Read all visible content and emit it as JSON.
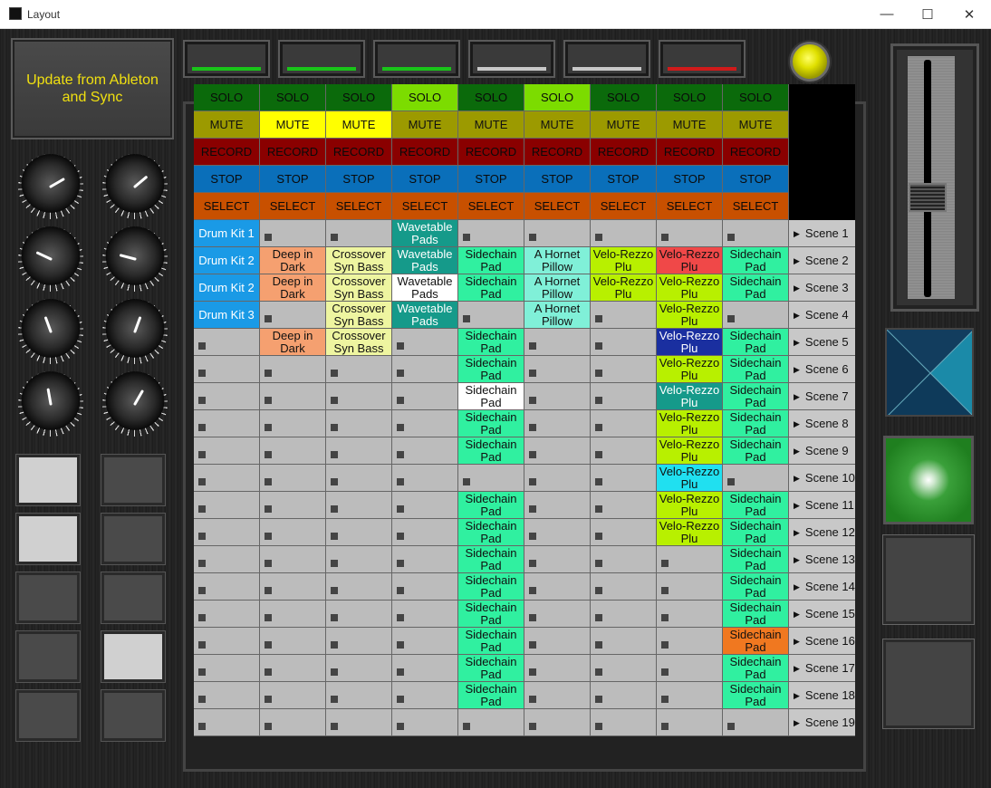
{
  "window": {
    "title": "Layout",
    "min": "—",
    "max": "☐",
    "close": "✕"
  },
  "update_button": "Update from Ableton and Sync",
  "meters": [
    {
      "color": "#19c419"
    },
    {
      "color": "#19c419"
    },
    {
      "color": "#19c419"
    },
    {
      "color": "#c8c8c8"
    },
    {
      "color": "#c8c8c8"
    },
    {
      "color": "#d01a1a"
    }
  ],
  "knob_angles": [
    [
      60,
      50
    ],
    [
      -65,
      -75
    ],
    [
      -20,
      20
    ],
    [
      -10,
      30
    ]
  ],
  "pads": [
    [
      "on",
      "off"
    ],
    [
      "on",
      "off"
    ],
    [
      "off",
      "off"
    ],
    [
      "off",
      "on"
    ],
    [
      "off",
      "off"
    ]
  ],
  "controls": {
    "solo": {
      "label": "SOLO",
      "colors": [
        "#0b6a0b",
        "#0b6a0b",
        "#0b6a0b",
        "#7cdc00",
        "#0b6a0b",
        "#7cdc00",
        "#0b6a0b",
        "#0b6a0b",
        "#0b6a0b"
      ]
    },
    "mute": {
      "label": "MUTE",
      "colors": [
        "#9c9a00",
        "#ffff00",
        "#ffff00",
        "#9c9a00",
        "#9c9a00",
        "#9c9a00",
        "#9c9a00",
        "#9c9a00",
        "#9c9a00"
      ]
    },
    "record": {
      "label": "RECORD",
      "colors": [
        "#8a0000",
        "#8a0000",
        "#8a0000",
        "#8a0000",
        "#8a0000",
        "#8a0000",
        "#8a0000",
        "#8a0000",
        "#8a0000"
      ]
    },
    "stop": {
      "label": "STOP",
      "colors": [
        "#0a6fba",
        "#0a6fba",
        "#0a6fba",
        "#0a6fba",
        "#0a6fba",
        "#0a6fba",
        "#0a6fba",
        "#0a6fba",
        "#0a6fba"
      ]
    },
    "select": {
      "label": "SELECT",
      "colors": [
        "#c85000",
        "#c85000",
        "#c85000",
        "#c85000",
        "#c85000",
        "#c85000",
        "#c85000",
        "#c85000",
        "#c85000"
      ]
    }
  },
  "clips": [
    [
      [
        "Drum Kit 1",
        "#1a9ae6"
      ],
      [
        "",
        ""
      ],
      [
        "",
        ""
      ],
      [
        "Wavetable Pads",
        "#159a8a"
      ],
      [
        "",
        ""
      ],
      [
        "",
        ""
      ],
      [
        "",
        ""
      ],
      [
        "",
        ""
      ],
      [
        "",
        ""
      ]
    ],
    [
      [
        "Drum Kit 2",
        "#1a9ae6"
      ],
      [
        "Deep in Dark",
        "#f5a070"
      ],
      [
        "Crossover Syn Bass",
        "#eef5a0"
      ],
      [
        "Wavetable Pads",
        "#159a8a"
      ],
      [
        "Sidechain Pad",
        "#30f0a0"
      ],
      [
        "A Hornet Pillow",
        "#80f0d8"
      ],
      [
        "Velo-Rezzo Plu",
        "#b8f000"
      ],
      [
        "Velo-Rezzo Plu",
        "#f04848"
      ],
      [
        "Sidechain Pad",
        "#30f0a0"
      ]
    ],
    [
      [
        "Drum Kit 2",
        "#1a9ae6"
      ],
      [
        "Deep in Dark",
        "#f5a070"
      ],
      [
        "Crossover Syn Bass",
        "#eef5a0"
      ],
      [
        "Wavetable Pads",
        "#ffffff"
      ],
      [
        "Sidechain Pad",
        "#30f0a0"
      ],
      [
        "A Hornet Pillow",
        "#80f0d8"
      ],
      [
        "Velo-Rezzo Plu",
        "#b8f000"
      ],
      [
        "Velo-Rezzo Plu",
        "#b8f000"
      ],
      [
        "Sidechain Pad",
        "#30f0a0"
      ]
    ],
    [
      [
        "Drum Kit 3",
        "#1a9ae6"
      ],
      [
        "",
        ""
      ],
      [
        "Crossover Syn Bass",
        "#eef5a0"
      ],
      [
        "Wavetable Pads",
        "#159a8a"
      ],
      [
        "",
        ""
      ],
      [
        "A Hornet Pillow",
        "#80f0d8"
      ],
      [
        "",
        ""
      ],
      [
        "Velo-Rezzo Plu",
        "#b8f000"
      ],
      [
        "",
        ""
      ]
    ],
    [
      [
        "",
        ""
      ],
      [
        "Deep in Dark",
        "#f5a070"
      ],
      [
        "Crossover Syn Bass",
        "#eef5a0"
      ],
      [
        "",
        ""
      ],
      [
        "Sidechain Pad",
        "#30f0a0"
      ],
      [
        "",
        ""
      ],
      [
        "",
        ""
      ],
      [
        "Velo-Rezzo Plu",
        "#1a2fa0"
      ],
      [
        "Sidechain Pad",
        "#30f0a0"
      ]
    ],
    [
      [
        "",
        ""
      ],
      [
        "",
        ""
      ],
      [
        "",
        ""
      ],
      [
        "",
        ""
      ],
      [
        "Sidechain Pad",
        "#30f0a0"
      ],
      [
        "",
        ""
      ],
      [
        "",
        ""
      ],
      [
        "Velo-Rezzo Plu",
        "#b8f000"
      ],
      [
        "Sidechain Pad",
        "#30f0a0"
      ]
    ],
    [
      [
        "",
        ""
      ],
      [
        "",
        ""
      ],
      [
        "",
        ""
      ],
      [
        "",
        ""
      ],
      [
        "Sidechain Pad",
        "#ffffff"
      ],
      [
        "",
        ""
      ],
      [
        "",
        ""
      ],
      [
        "Velo-Rezzo Plu",
        "#159a8a"
      ],
      [
        "Sidechain Pad",
        "#30f0a0"
      ]
    ],
    [
      [
        "",
        ""
      ],
      [
        "",
        ""
      ],
      [
        "",
        ""
      ],
      [
        "",
        ""
      ],
      [
        "Sidechain Pad",
        "#30f0a0"
      ],
      [
        "",
        ""
      ],
      [
        "",
        ""
      ],
      [
        "Velo-Rezzo Plu",
        "#b8f000"
      ],
      [
        "Sidechain Pad",
        "#30f0a0"
      ]
    ],
    [
      [
        "",
        ""
      ],
      [
        "",
        ""
      ],
      [
        "",
        ""
      ],
      [
        "",
        ""
      ],
      [
        "Sidechain Pad",
        "#30f0a0"
      ],
      [
        "",
        ""
      ],
      [
        "",
        ""
      ],
      [
        "Velo-Rezzo Plu",
        "#b8f000"
      ],
      [
        "Sidechain Pad",
        "#30f0a0"
      ]
    ],
    [
      [
        "",
        ""
      ],
      [
        "",
        ""
      ],
      [
        "",
        ""
      ],
      [
        "",
        ""
      ],
      [
        "",
        ""
      ],
      [
        "",
        ""
      ],
      [
        "",
        ""
      ],
      [
        "Velo-Rezzo Plu",
        "#20e0f0"
      ],
      [
        "",
        ""
      ]
    ],
    [
      [
        "",
        ""
      ],
      [
        "",
        ""
      ],
      [
        "",
        ""
      ],
      [
        "",
        ""
      ],
      [
        "Sidechain Pad",
        "#30f0a0"
      ],
      [
        "",
        ""
      ],
      [
        "",
        ""
      ],
      [
        "Velo-Rezzo Plu",
        "#b8f000"
      ],
      [
        "Sidechain Pad",
        "#30f0a0"
      ]
    ],
    [
      [
        "",
        ""
      ],
      [
        "",
        ""
      ],
      [
        "",
        ""
      ],
      [
        "",
        ""
      ],
      [
        "Sidechain Pad",
        "#30f0a0"
      ],
      [
        "",
        ""
      ],
      [
        "",
        ""
      ],
      [
        "Velo-Rezzo Plu",
        "#b8f000"
      ],
      [
        "Sidechain Pad",
        "#30f0a0"
      ]
    ],
    [
      [
        "",
        ""
      ],
      [
        "",
        ""
      ],
      [
        "",
        ""
      ],
      [
        "",
        ""
      ],
      [
        "Sidechain Pad",
        "#30f0a0"
      ],
      [
        "",
        ""
      ],
      [
        "",
        ""
      ],
      [
        "",
        ""
      ],
      [
        "Sidechain Pad",
        "#30f0a0"
      ]
    ],
    [
      [
        "",
        ""
      ],
      [
        "",
        ""
      ],
      [
        "",
        ""
      ],
      [
        "",
        ""
      ],
      [
        "Sidechain Pad",
        "#30f0a0"
      ],
      [
        "",
        ""
      ],
      [
        "",
        ""
      ],
      [
        "",
        ""
      ],
      [
        "Sidechain Pad",
        "#30f0a0"
      ]
    ],
    [
      [
        "",
        ""
      ],
      [
        "",
        ""
      ],
      [
        "",
        ""
      ],
      [
        "",
        ""
      ],
      [
        "Sidechain Pad",
        "#30f0a0"
      ],
      [
        "",
        ""
      ],
      [
        "",
        ""
      ],
      [
        "",
        ""
      ],
      [
        "Sidechain Pad",
        "#30f0a0"
      ]
    ],
    [
      [
        "",
        ""
      ],
      [
        "",
        ""
      ],
      [
        "",
        ""
      ],
      [
        "",
        ""
      ],
      [
        "Sidechain Pad",
        "#30f0a0"
      ],
      [
        "",
        ""
      ],
      [
        "",
        ""
      ],
      [
        "",
        ""
      ],
      [
        "Sidechain Pad",
        "#f07820"
      ]
    ],
    [
      [
        "",
        ""
      ],
      [
        "",
        ""
      ],
      [
        "",
        ""
      ],
      [
        "",
        ""
      ],
      [
        "Sidechain Pad",
        "#30f0a0"
      ],
      [
        "",
        ""
      ],
      [
        "",
        ""
      ],
      [
        "",
        ""
      ],
      [
        "Sidechain Pad",
        "#30f0a0"
      ]
    ],
    [
      [
        "",
        ""
      ],
      [
        "",
        ""
      ],
      [
        "",
        ""
      ],
      [
        "",
        ""
      ],
      [
        "Sidechain Pad",
        "#30f0a0"
      ],
      [
        "",
        ""
      ],
      [
        "",
        ""
      ],
      [
        "",
        ""
      ],
      [
        "Sidechain Pad",
        "#30f0a0"
      ]
    ],
    [
      [
        "",
        ""
      ],
      [
        "",
        ""
      ],
      [
        "",
        ""
      ],
      [
        "",
        ""
      ],
      [
        "",
        ""
      ],
      [
        "",
        ""
      ],
      [
        "",
        ""
      ],
      [
        "",
        ""
      ],
      [
        "",
        ""
      ]
    ]
  ],
  "scenes": [
    "Scene 1",
    "Scene 2",
    "Scene 3",
    "Scene 4",
    "Scene 5",
    "Scene 6",
    "Scene 7",
    "Scene 8",
    "Scene 9",
    "Scene 10",
    "Scene 11",
    "Scene 12",
    "Scene 13",
    "Scene 14",
    "Scene 15",
    "Scene 16",
    "Scene 17",
    "Scene 18",
    "Scene 19"
  ],
  "empty_cell_color": "#bcbcbc",
  "led_color": "#e0e000"
}
